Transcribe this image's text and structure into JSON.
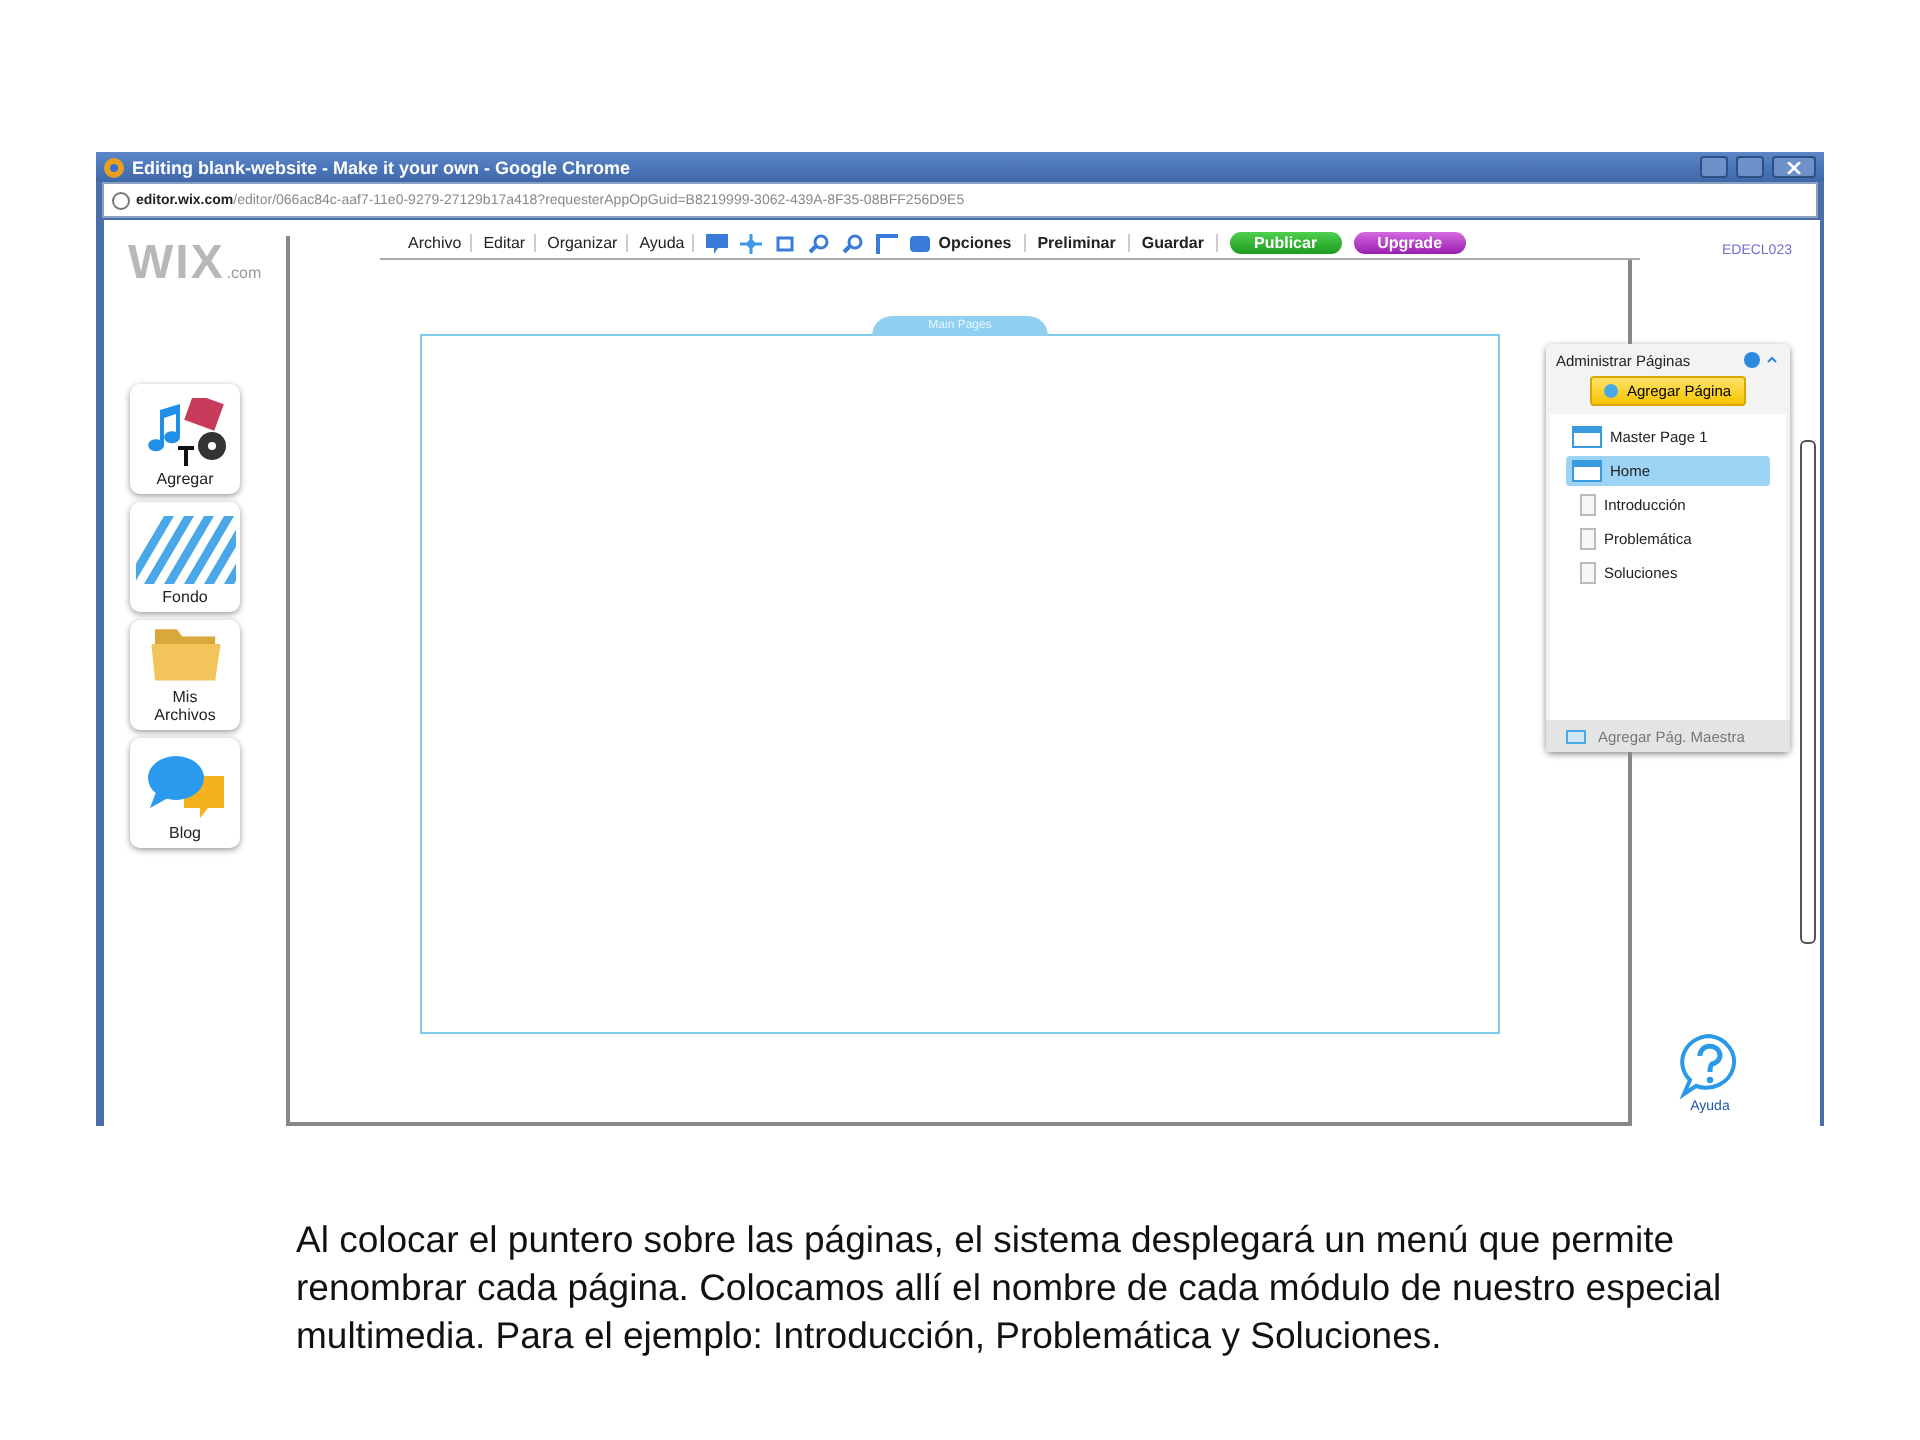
{
  "window": {
    "title": "Editing blank-website - Make it your own - Google Chrome"
  },
  "address_bar": {
    "url": "**editor.wix.com**/editor/066ac84c-aaf7-11e0-9279-27129b17a418?requesterAppOpGuid=B8219999-3062-439A-8F35-08BFF256D9E5"
  },
  "logo": {
    "text": "WIX",
    "suffix": ".com"
  },
  "menu": [
    "Archivo",
    "Editar",
    "Organizar",
    "Ayuda"
  ],
  "toolbar": {
    "options": "Opciones",
    "preview": "Preliminar",
    "save": "Guardar",
    "publish": "Publicar",
    "upgrade": "Upgrade"
  },
  "user_id": "EDECL023",
  "canvas": {
    "tab": "Main Pages"
  },
  "side_tools": [
    {
      "label": "Agregar",
      "kind": "add"
    },
    {
      "label": "Fondo",
      "kind": "background"
    },
    {
      "label": "Mis Archivos",
      "kind": "files"
    },
    {
      "label": "Blog",
      "kind": "blog"
    }
  ],
  "pages_panel": {
    "title": "Administrar Páginas",
    "add_button": "Agregar Página",
    "footer": "Agregar Pág. Maestra",
    "pages": [
      {
        "name": "Master Page 1",
        "kind": "master",
        "selected": false
      },
      {
        "name": "Home",
        "kind": "master",
        "selected": true
      },
      {
        "name": "Introducción",
        "kind": "page",
        "selected": false
      },
      {
        "name": "Problemática",
        "kind": "page",
        "selected": false
      },
      {
        "name": "Soluciones",
        "kind": "page",
        "selected": false
      }
    ]
  },
  "help": {
    "label": "Ayuda"
  },
  "caption": "Al colocar el puntero sobre las páginas, el sistema desplegará un menú que permite renombrar cada página. Colocamos allí el nombre de cada módulo de nuestro especial multimedia. Para el ejemplo: Introducción, Problemática y Soluciones."
}
